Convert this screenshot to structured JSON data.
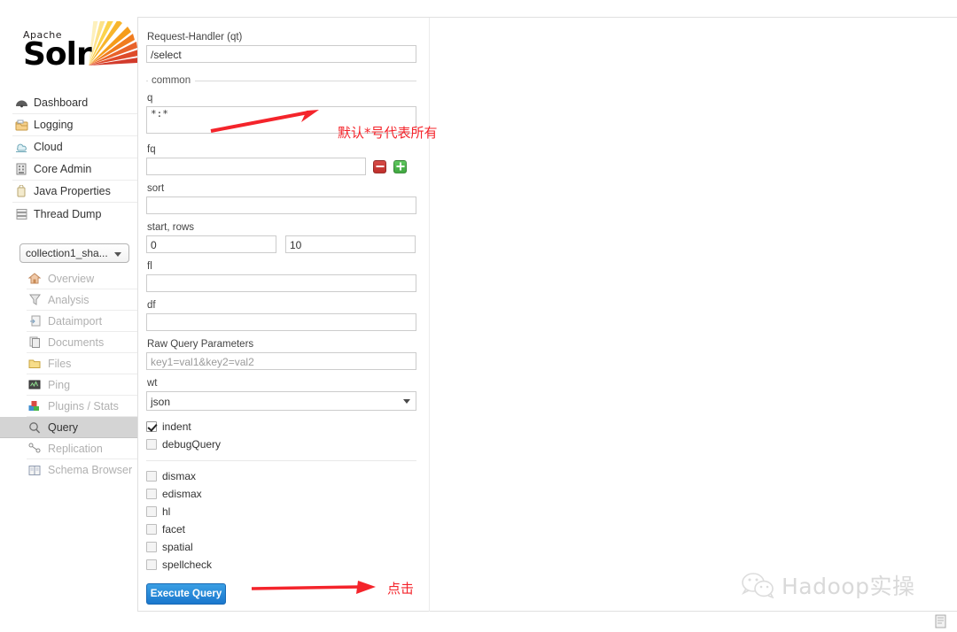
{
  "brand": {
    "apache": "Apache",
    "name": "Solr",
    "logo_icon": "solr-sunburst-logo"
  },
  "sidebar": {
    "items": [
      {
        "label": "Dashboard",
        "icon": "dashboard-icon"
      },
      {
        "label": "Logging",
        "icon": "logging-icon"
      },
      {
        "label": "Cloud",
        "icon": "cloud-icon"
      },
      {
        "label": "Core Admin",
        "icon": "core-admin-icon"
      },
      {
        "label": "Java Properties",
        "icon": "java-properties-icon"
      },
      {
        "label": "Thread Dump",
        "icon": "thread-dump-icon"
      }
    ],
    "core_selector": {
      "value": "collection1_sha...",
      "caret_icon": "chevron-down-icon"
    },
    "core_items": [
      {
        "label": "Overview",
        "icon": "home-icon",
        "active": false
      },
      {
        "label": "Analysis",
        "icon": "funnel-icon",
        "active": false
      },
      {
        "label": "Dataimport",
        "icon": "dataimport-icon",
        "active": false
      },
      {
        "label": "Documents",
        "icon": "documents-icon",
        "active": false
      },
      {
        "label": "Files",
        "icon": "folder-icon",
        "active": false
      },
      {
        "label": "Ping",
        "icon": "ping-icon",
        "active": false
      },
      {
        "label": "Plugins / Stats",
        "icon": "plugins-icon",
        "active": false
      },
      {
        "label": "Query",
        "icon": "magnifier-icon",
        "active": true
      },
      {
        "label": "Replication",
        "icon": "replication-icon",
        "active": false
      },
      {
        "label": "Schema Browser",
        "icon": "book-icon",
        "active": false
      }
    ]
  },
  "query_form": {
    "request_handler": {
      "label": "Request-Handler (qt)",
      "value": "/select"
    },
    "common_legend": "common",
    "q": {
      "label": "q",
      "value": "*:*"
    },
    "fq": {
      "label": "fq",
      "value": "",
      "remove_icon": "minus-icon",
      "add_icon": "plus-icon"
    },
    "sort": {
      "label": "sort",
      "value": ""
    },
    "start_rows": {
      "label": "start, rows",
      "start": "0",
      "rows": "10"
    },
    "fl": {
      "label": "fl",
      "value": ""
    },
    "df": {
      "label": "df",
      "value": ""
    },
    "raw_query_parameters": {
      "label": "Raw Query Parameters",
      "placeholder": "key1=val1&key2=val2"
    },
    "wt": {
      "label": "wt",
      "value": "json",
      "caret_icon": "chevron-down-icon"
    },
    "checkboxes_primary": [
      {
        "label": "indent",
        "checked": true
      },
      {
        "label": "debugQuery",
        "checked": false
      }
    ],
    "checkboxes_secondary": [
      {
        "label": "dismax",
        "checked": false
      },
      {
        "label": "edismax",
        "checked": false
      },
      {
        "label": "hl",
        "checked": false
      },
      {
        "label": "facet",
        "checked": false
      },
      {
        "label": "spatial",
        "checked": false
      },
      {
        "label": "spellcheck",
        "checked": false
      }
    ],
    "execute_button": "Execute Query"
  },
  "annotations": {
    "q_note": "默认*号代表所有",
    "click_note": "点击",
    "arrow_color": "#f4242b"
  },
  "watermark": {
    "text": "Hadoop实操",
    "icon": "wechat-icon"
  },
  "corner": {
    "icon": "page-icon"
  },
  "colors": {
    "accent_blue": "#1a77cd",
    "add_green": "#3fa73f",
    "remove_red": "#bf2f2b",
    "annotation_red": "#f4242b",
    "active_nav": "#d4d4d4"
  }
}
